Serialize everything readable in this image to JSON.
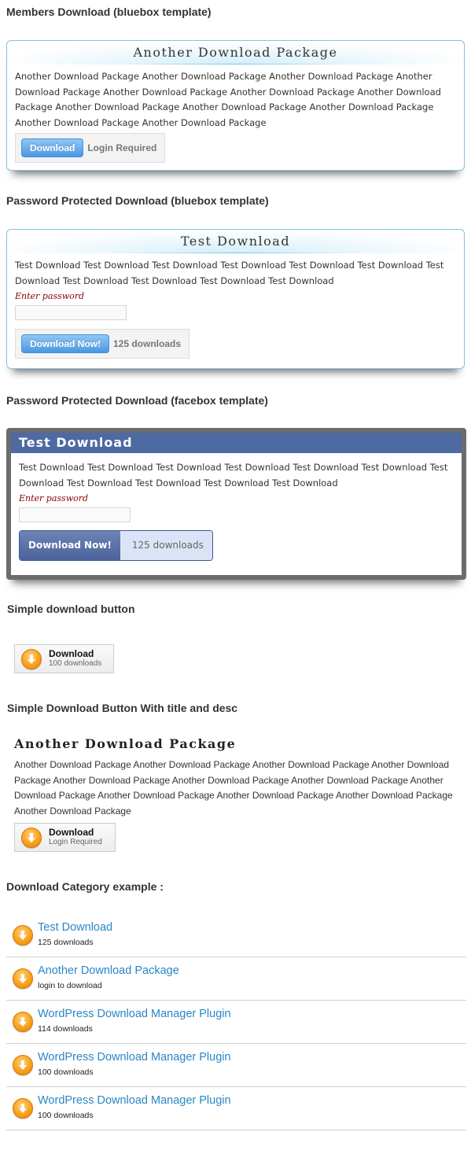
{
  "sections": {
    "members": "Members Download (bluebox template)",
    "password_bluebox": "Password Protected Download (bluebox template)",
    "password_facebox": "Password Protected Download (facebox template)",
    "simple": "Simple download button",
    "simple_title_desc": "Simple Download Button With title and desc",
    "category": "Download Category example :"
  },
  "bluebox1": {
    "title": "Another Download Package",
    "desc": "Another Download Package Another Download Package Another Download Package Another Download Package Another Download Package Another Download Package Another Download Package Another Download Package Another Download Package Another Download Package Another Download Package Another Download Package",
    "button": "Download",
    "info": "Login Required"
  },
  "bluebox2": {
    "title": "Test Download",
    "desc": "Test Download Test Download Test Download Test Download Test Download Test Download Test Download Test Download Test Download Test Download Test Download",
    "pw_label": "Enter password",
    "button": "Download Now!",
    "info": "125 downloads"
  },
  "facebox": {
    "title": "Test Download",
    "desc": "Test Download Test Download Test Download Test Download Test Download Test Download Test Download Test Download Test Download Test Download Test Download",
    "pw_label": "Enter password",
    "button": "Download Now!",
    "info": "125 downloads"
  },
  "simple1": {
    "title": "Download",
    "info": "100 downloads"
  },
  "simple2": {
    "pkg_title": "Another Download Package",
    "desc": "Another Download Package Another Download Package Another Download Package Another Download Package Another Download Package Another Download Package Another Download Package Another Download Package Another Download Package Another Download Package Another Download Package Another Download Package",
    "title": "Download",
    "info": "Login Required"
  },
  "category_items": [
    {
      "title": "Test Download",
      "info": "125 downloads"
    },
    {
      "title": "Another Download Package",
      "info": "login to download"
    },
    {
      "title": "WordPress Download Manager Plugin",
      "info": "114 downloads"
    },
    {
      "title": "WordPress Download Manager Plugin",
      "info": "100 downloads"
    },
    {
      "title": "WordPress Download Manager Plugin",
      "info": "100 downloads"
    }
  ],
  "icons": {
    "download": "download-arrow-icon"
  },
  "colors": {
    "bluebox_border": "#7fc4e2",
    "facebox_header": "#4e6aa3",
    "link": "#2a86c8",
    "password_label": "#8b0000"
  }
}
